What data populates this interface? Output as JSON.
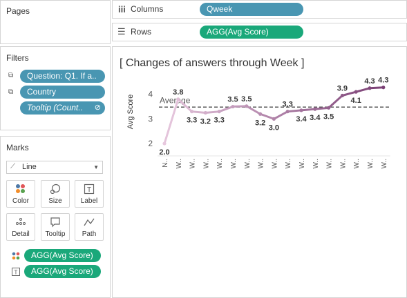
{
  "pages": {
    "title": "Pages"
  },
  "shelves": {
    "columns": {
      "label": "Columns",
      "pill": "Qweek"
    },
    "rows": {
      "label": "Rows",
      "pill": "AGG(Avg Score)"
    }
  },
  "filters": {
    "title": "Filters",
    "items": [
      "Question: Q1. If a..",
      "Country",
      "Tooltip (Count.."
    ]
  },
  "marks": {
    "title": "Marks",
    "mark_type": "Line",
    "buttons": [
      "Color",
      "Size",
      "Label",
      "Detail",
      "Tooltip",
      "Path"
    ],
    "pills": [
      "AGG(Avg Score)",
      "AGG(Avg Score)"
    ]
  },
  "colors": {
    "blue_pill": "#4996b2",
    "green_pill": "#1aa87a",
    "line_start": "#e7c8de",
    "line_end": "#7a3f74"
  },
  "chart_data": {
    "type": "line",
    "title": "[ Changes of answers through Week ]",
    "ylabel": "Avg Score",
    "ylim": [
      1.75,
      4.3
    ],
    "yticks": [
      2,
      3,
      4
    ],
    "x": [
      "N..",
      "W..",
      "W..",
      "W..",
      "W..",
      "W..",
      "W..",
      "W..",
      "W..",
      "W..",
      "W..",
      "W..",
      "W..",
      "W..",
      "W..",
      "W..",
      "W.."
    ],
    "values": [
      2.0,
      3.8,
      3.3,
      3.25,
      3.3,
      3.5,
      3.52,
      3.2,
      3.0,
      3.3,
      3.35,
      3.4,
      3.45,
      3.95,
      4.1,
      4.25,
      4.28
    ],
    "labels": [
      "2.0",
      "3.8",
      "3.3",
      "3.2",
      "3.3",
      "3.5",
      "3.5",
      "3.2",
      "3.0",
      "3.3",
      "3.4",
      "3.4",
      "3.5",
      "3.9",
      "4.1",
      "4.3",
      "4.3"
    ],
    "reference_line": {
      "label": "Average",
      "value": 3.48
    },
    "grid": false
  }
}
